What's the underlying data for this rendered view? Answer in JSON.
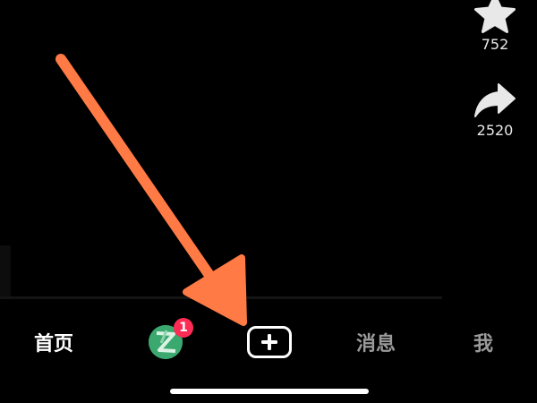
{
  "actions": {
    "favorite": {
      "count": "752",
      "icon": "star-icon"
    },
    "share": {
      "count": "2520",
      "icon": "share-arrow-icon"
    }
  },
  "tabbar": {
    "home_label": "首页",
    "friends_badge": "1",
    "create_icon": "plus-icon",
    "messages_label": "消息",
    "me_label": "我"
  },
  "colors": {
    "background": "#000000",
    "badge": "#fe2c55",
    "annotation_arrow": "#ff7a45",
    "active_tab": "#ffffff",
    "inactive_tab": "#9a9a9a"
  }
}
